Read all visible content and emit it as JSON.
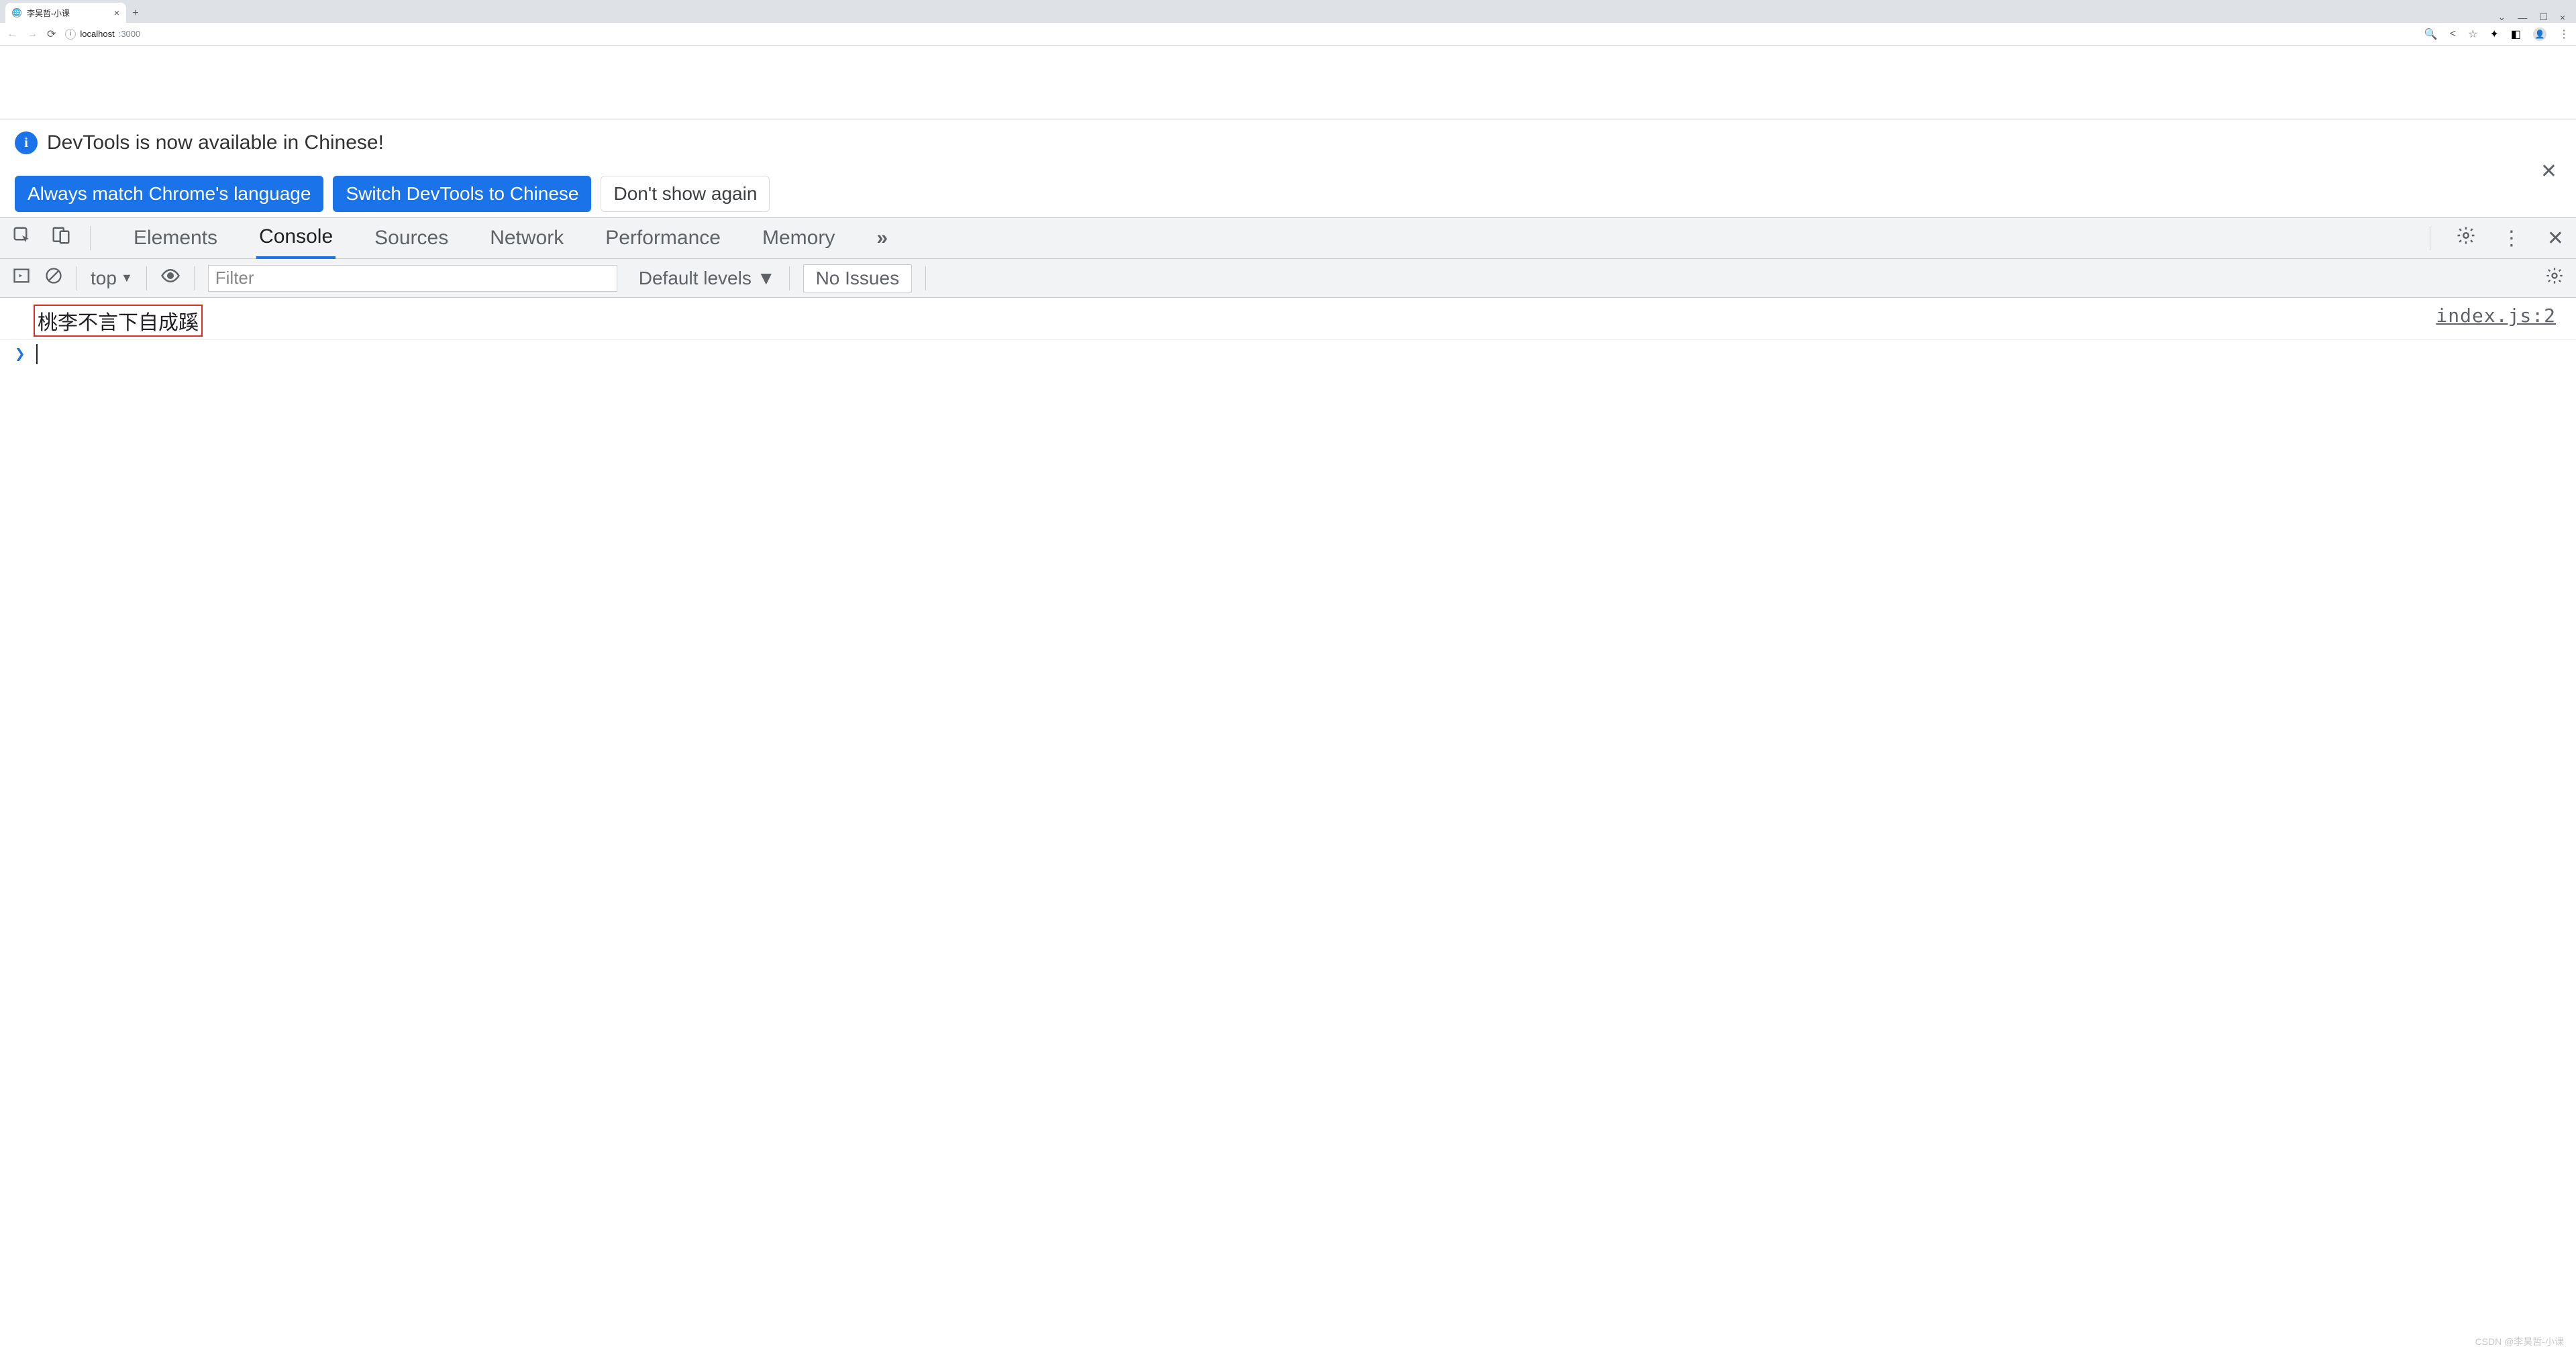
{
  "browser": {
    "tab_title": "李昊哲-小课",
    "url_host": "localhost",
    "url_port": ":3000"
  },
  "notice": {
    "message": "DevTools is now available in Chinese!",
    "btn_match": "Always match Chrome's language",
    "btn_switch": "Switch DevTools to Chinese",
    "btn_dismiss": "Don't show again"
  },
  "devtools_tabs": {
    "elements": "Elements",
    "console": "Console",
    "sources": "Sources",
    "network": "Network",
    "performance": "Performance",
    "memory": "Memory",
    "more": "»"
  },
  "console_toolbar": {
    "context": "top",
    "filter_placeholder": "Filter",
    "levels": "Default levels",
    "issues": "No Issues"
  },
  "console_log": {
    "message": "桃李不言下自成蹊",
    "source": "index.js:2",
    "prompt": "❯"
  },
  "watermark": "CSDN @李昊哲-小课"
}
